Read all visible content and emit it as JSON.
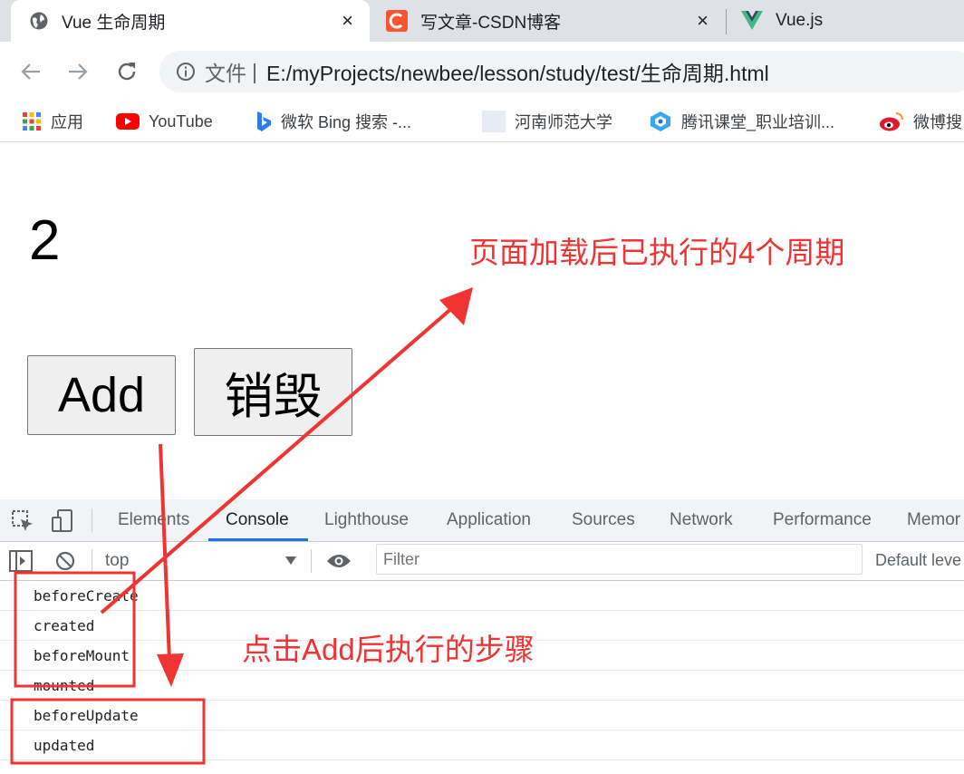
{
  "browser": {
    "tabs": [
      {
        "title": "Vue 生命周期",
        "icon": "globe-icon",
        "active": true,
        "close": "×"
      },
      {
        "title": "写文章-CSDN博客",
        "icon": "csdn-logo-icon",
        "active": false,
        "close": "×"
      },
      {
        "title": "Vue.js",
        "icon": "vue-logo-icon",
        "active": false
      }
    ],
    "address": {
      "label": "文件",
      "separator": "|",
      "url": "E:/myProjects/newbee/lesson/study/test/生命周期.html"
    },
    "bookmarks": [
      {
        "label": "应用",
        "icon": "apps-grid-icon"
      },
      {
        "label": "YouTube",
        "icon": "youtube-icon"
      },
      {
        "label": "微软 Bing 搜索 -...",
        "icon": "bing-icon"
      },
      {
        "label": "河南师范大学",
        "icon": "page-icon"
      },
      {
        "label": "腾讯课堂_职业培训...",
        "icon": "tencent-classroom-icon"
      },
      {
        "label": "微博搜",
        "icon": "weibo-icon"
      }
    ]
  },
  "page": {
    "counter": "2",
    "add_button": "Add",
    "destroy_button": "销毁"
  },
  "devtools": {
    "tabs": [
      "Elements",
      "Console",
      "Lighthouse",
      "Application",
      "Sources",
      "Network",
      "Performance",
      "Memor"
    ],
    "active_tab": "Console",
    "context": "top",
    "filter_placeholder": "Filter",
    "levels": "Default leve",
    "console_lines": [
      "beforeCreate",
      "created",
      "beforeMount",
      "mounted",
      "beforeUpdate",
      "updated"
    ]
  },
  "annotations": {
    "top": "页面加载后已执行的4个周期",
    "bottom": "点击Add后执行的步骤",
    "color": "#f03333"
  }
}
